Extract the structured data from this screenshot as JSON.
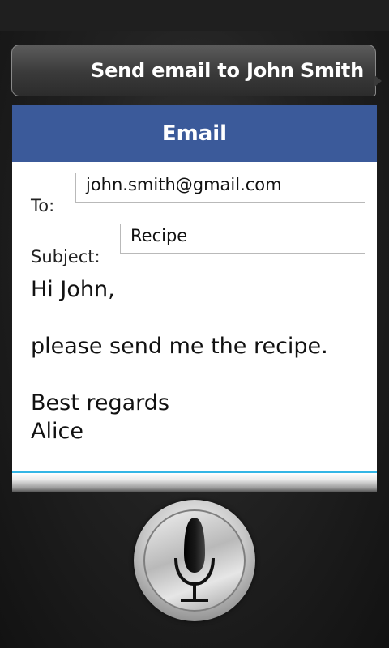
{
  "prompt": {
    "text": "Send email to John Smith"
  },
  "card": {
    "title": "Email",
    "to_label": "To:",
    "to_value": "john.smith@gmail.com",
    "subject_label": "Subject:",
    "subject_value": "Recipe",
    "body": "Hi John,\n\nplease send me the recipe.\n\nBest regards\nAlice"
  },
  "colors": {
    "header": "#3b5a9a",
    "accent": "#33b5e5"
  },
  "icons": {
    "mic": "microphone-icon"
  }
}
